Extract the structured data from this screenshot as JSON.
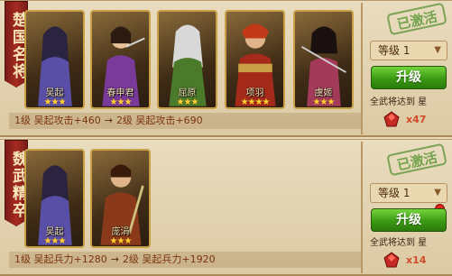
{
  "groups": [
    {
      "title": "楚国名将",
      "generals": [
        {
          "name": "吴起",
          "stars": "★★★",
          "color": "#5a4fa6"
        },
        {
          "name": "春申君",
          "stars": "★★★",
          "color": "#7a3a9a"
        },
        {
          "name": "屈原",
          "stars": "★★★",
          "color": "#4a7a2a"
        },
        {
          "name": "项羽",
          "stars": "★★★★",
          "color": "#a52a1a"
        },
        {
          "name": "虞姬",
          "stars": "★★★",
          "color": "#a33a5a"
        }
      ],
      "bonus_from": "1级 吴起攻击+460",
      "arrow": "→",
      "bonus_to": "2级 吴起攻击+690",
      "stamp": "已激活",
      "level": "等级 1",
      "upgrade_label": "升级",
      "requirement": "全武将达到  星",
      "cost": "x47"
    },
    {
      "title": "魏武精卒",
      "generals": [
        {
          "name": "吴起",
          "stars": "★★★",
          "color": "#5a4fa6"
        },
        {
          "name": "庞涓",
          "stars": "★★★",
          "color": "#8a3a1a"
        }
      ],
      "bonus_from": "1级 吴起兵力+1280",
      "arrow": "→",
      "bonus_to": "2级 吴起兵力+1920",
      "stamp": "已激活",
      "level": "等级 1",
      "upgrade_label": "升级",
      "requirement": "全武将达到  星",
      "cost": "x14"
    }
  ]
}
